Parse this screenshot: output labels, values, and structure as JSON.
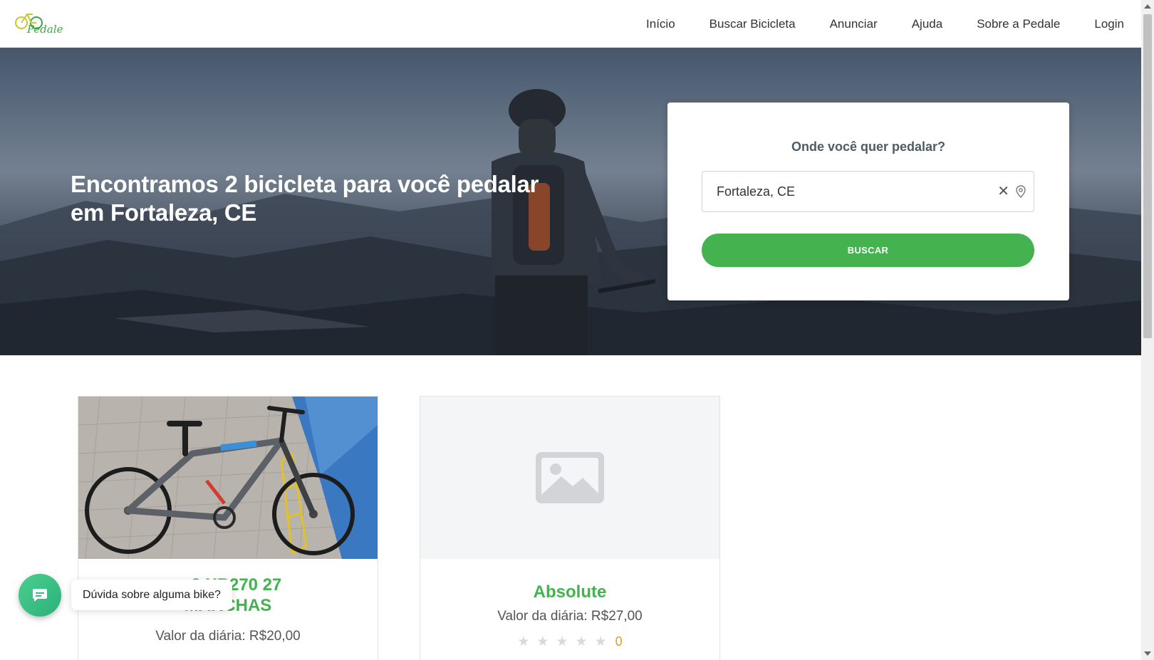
{
  "header": {
    "logo_text": "Pedale",
    "nav": [
      "Início",
      "Buscar Bicicleta",
      "Anunciar",
      "Ajuda",
      "Sobre a Pedale",
      "Login"
    ]
  },
  "hero": {
    "title": "Encontramos 2 bicicleta para você pedalar em Fortaleza, CE"
  },
  "search": {
    "question": "Onde você quer pedalar?",
    "location_value": "Fortaleza, CE",
    "clear_icon": "close-icon",
    "pin_icon": "map-pin-icon",
    "button_label": "BUSCAR"
  },
  "listings": [
    {
      "title": "…9 XR270 27 MARCHAS",
      "title_line1": "…9 XR270 27",
      "title_line2": "MARCHAS",
      "price": "Valor da diária: R$20,00",
      "image": "bike-photo"
    },
    {
      "title": "Absolute",
      "price": "Valor da diária: R$27,00",
      "rating_count": "0",
      "image": "image-placeholder-icon"
    }
  ],
  "chat": {
    "tooltip": "Dúvida sobre alguma bike?"
  },
  "colors": {
    "accent_green": "#43b24f",
    "title_green": "#43b24f",
    "star_gray": "#d9d9d9",
    "rating_orange": "#e0a020"
  }
}
